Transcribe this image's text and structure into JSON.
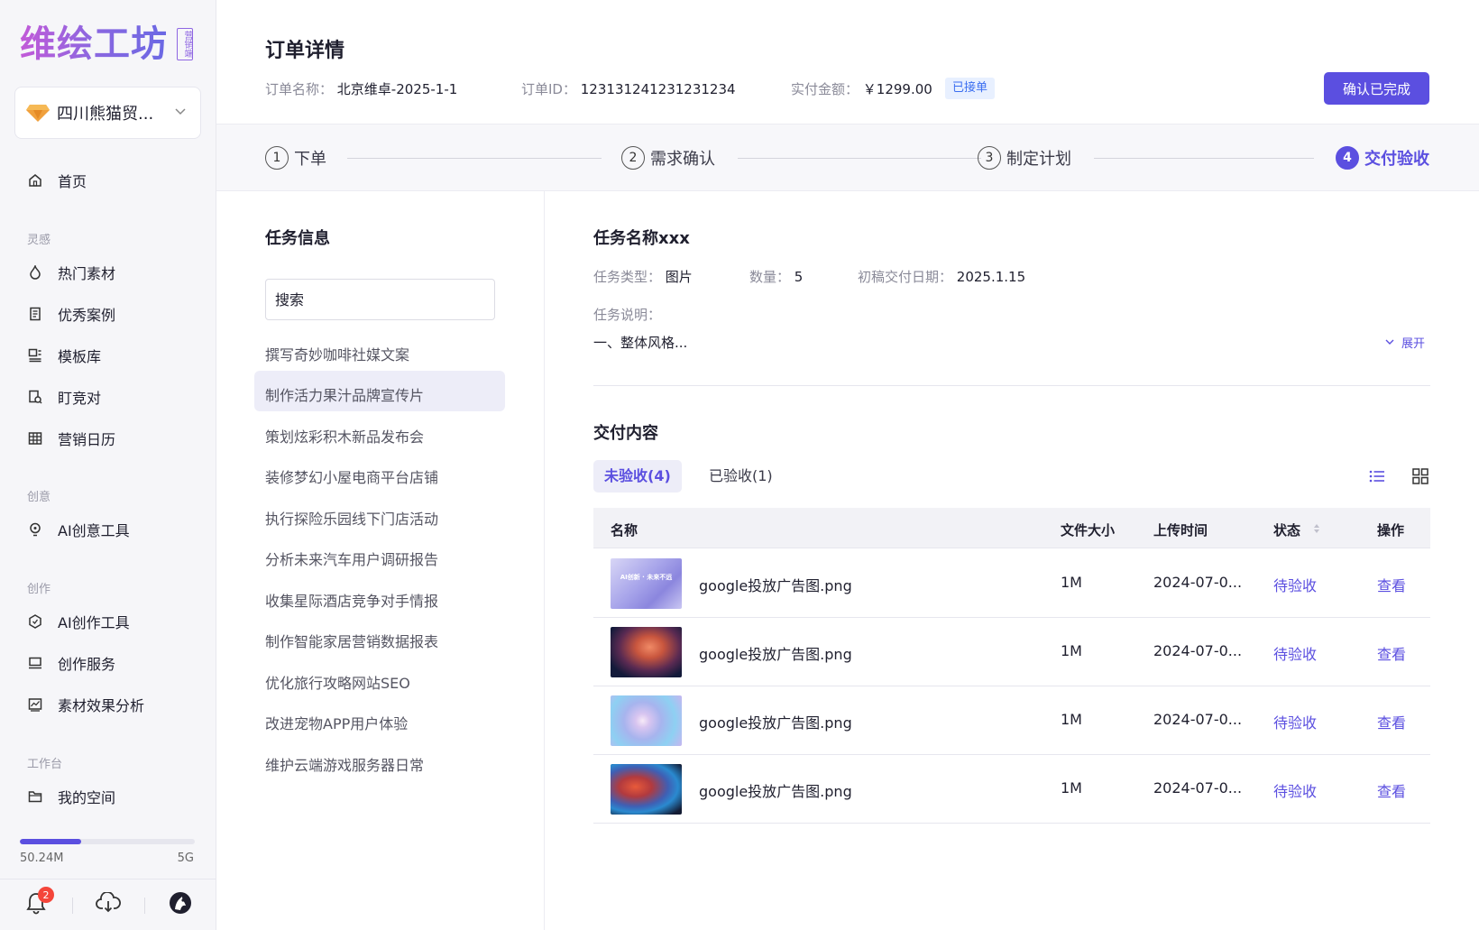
{
  "sidebar": {
    "logo": "维绘工坊",
    "logo_tag": "营销端",
    "org_name": "四川熊猫贸...",
    "home": "首页",
    "groups": [
      {
        "title": "灵感",
        "items": [
          "热门素材",
          "优秀案例",
          "模板库",
          "盯竞对",
          "营销日历"
        ]
      },
      {
        "title": "创意",
        "items": [
          "AI创意工具"
        ]
      },
      {
        "title": "创作",
        "items": [
          "AI创作工具",
          "创作服务",
          "素材效果分析"
        ]
      },
      {
        "title": "工作台",
        "items": [
          "我的空间"
        ]
      }
    ],
    "storage": {
      "used": "50.24M",
      "total": "5G",
      "fraction": 0.35
    },
    "notification_count": "2"
  },
  "header": {
    "title": "订单详情",
    "order_name_label": "订单名称：",
    "order_name": "北京维卓-2025-1-1",
    "order_id_label": "订单ID：",
    "order_id": "123131241231231234",
    "amount_label": "实付金额：",
    "amount": "￥1299.00",
    "status_tag": "已接单",
    "confirm_button": "确认已完成"
  },
  "steps": [
    {
      "num": "1",
      "label": "下单"
    },
    {
      "num": "2",
      "label": "需求确认"
    },
    {
      "num": "3",
      "label": "制定计划"
    },
    {
      "num": "4",
      "label": "交付验收"
    }
  ],
  "tasks": {
    "title": "任务信息",
    "search_placeholder": "搜索",
    "items": [
      "撰写奇妙咖啡社媒文案",
      "制作活力果汁品牌宣传片",
      "策划炫彩积木新品发布会",
      "装修梦幻小屋电商平台店铺",
      "执行探险乐园线下门店活动",
      "分析未来汽车用户调研报告",
      "收集星际酒店竞争对手情报",
      "制作智能家居营销数据报表",
      "优化旅行攻略网站SEO",
      "改进宠物APP用户体验",
      "维护云端游戏服务器日常"
    ]
  },
  "detail": {
    "task_name": "任务名称xxx",
    "type_label": "任务类型：",
    "type": "图片",
    "count_label": "数量：",
    "count": "5",
    "date_label": "初稿交付日期：",
    "date": "2025.1.15",
    "desc_label": "任务说明：",
    "desc": "一、整体风格...",
    "expand": "展开",
    "delivery_title": "交付内容",
    "tab_pending": "未验收(4)",
    "tab_accepted": "已验收(1)",
    "columns": [
      "名称",
      "文件大小",
      "上传时间",
      "状态",
      "操作"
    ],
    "rows": [
      {
        "name": "google投放广告图.png",
        "size": "1M",
        "time": "2024-07-0...",
        "status": "待验收",
        "action": "查看",
        "thumb_text": "AI创新 · 未来不远"
      },
      {
        "name": "google投放广告图.png",
        "size": "1M",
        "time": "2024-07-0...",
        "status": "待验收",
        "action": "查看"
      },
      {
        "name": "google投放广告图.png",
        "size": "1M",
        "time": "2024-07-0...",
        "status": "待验收",
        "action": "查看"
      },
      {
        "name": "google投放广告图.png",
        "size": "1M",
        "time": "2024-07-0...",
        "status": "待验收",
        "action": "查看"
      }
    ]
  },
  "colors": {
    "accent": "#5b4fe0",
    "tag_blue": "#3b6ef0",
    "badge_red": "#f4453a"
  }
}
